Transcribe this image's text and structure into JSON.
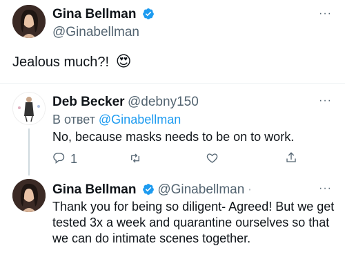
{
  "main_tweet": {
    "author_name": "Gina Bellman",
    "author_handle": "@Ginabellman",
    "text": "Jealous much?!",
    "emoji": "😍",
    "more_icon": "ellipsis-icon",
    "verified_icon": "verified-badge-icon"
  },
  "reply_1": {
    "author_name": "Deb Becker",
    "author_handle": "@debny150",
    "reply_to_prefix": "В ответ",
    "reply_to_handle": "@Ginabellman",
    "text": "No, because masks needs to be on to work.",
    "reply_count": "1",
    "more_icon": "ellipsis-icon"
  },
  "reply_2": {
    "author_name": "Gina Bellman",
    "author_handle": "@Ginabellman",
    "separator": "·",
    "text": "Thank you for being so diligent- Agreed! But we get tested 3x a week and quarantine ourselves so that we can do intimate scenes together.",
    "more_icon": "ellipsis-icon"
  },
  "colors": {
    "accent": "#1d9bf0",
    "secondary_text": "#536471",
    "primary_text": "#0f1419",
    "thread_line": "#cfd9de"
  }
}
